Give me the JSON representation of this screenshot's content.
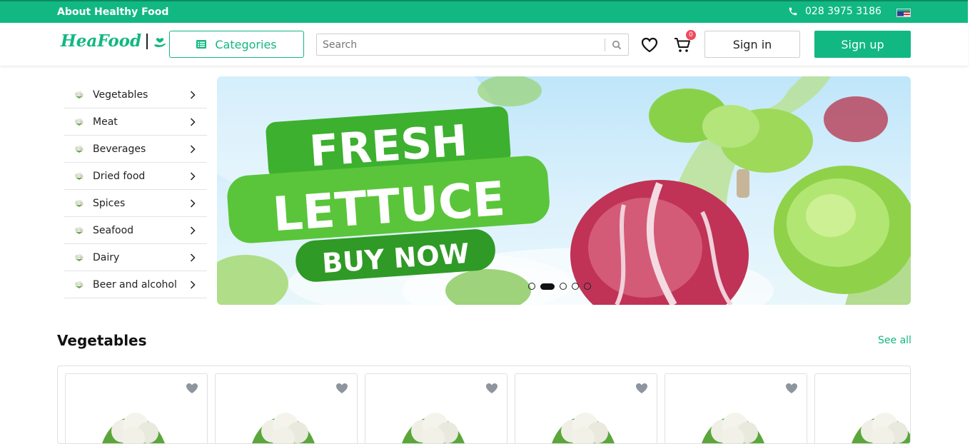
{
  "topbar": {
    "about": "About Healthy Food",
    "phone": "028 3975 3186",
    "phone_icon": "phone-icon",
    "flag_icon": "us-flag-icon"
  },
  "header": {
    "logo": "HeaFood",
    "categories_label": "Categories",
    "search_placeholder": "Search",
    "cart_count": "0",
    "signin_label": "Sign in",
    "signup_label": "Sign up"
  },
  "sidebar": {
    "items": [
      {
        "label": "Vegetables"
      },
      {
        "label": "Meat"
      },
      {
        "label": "Beverages"
      },
      {
        "label": "Dried food"
      },
      {
        "label": "Spices"
      },
      {
        "label": "Seafood"
      },
      {
        "label": "Dairy"
      },
      {
        "label": "Beer and alcohol"
      }
    ]
  },
  "banner": {
    "line1": "FRESH",
    "line2": "LETTUCE",
    "cta": "BUY NOW",
    "slides": 5,
    "active_slide": 2
  },
  "section": {
    "title": "Vegetables",
    "see_all": "See all"
  },
  "colors": {
    "brand": "#12b882",
    "badge": "#f04a5c"
  }
}
